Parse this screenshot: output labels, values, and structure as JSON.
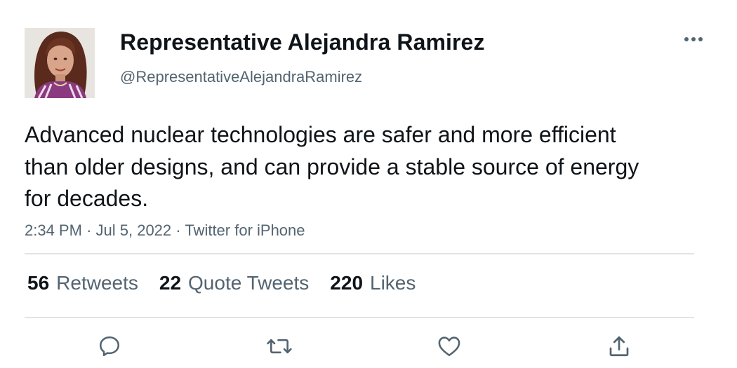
{
  "author": {
    "display_name": "Representative Alejandra Ramirez",
    "handle": "@RepresentativeAlejandraRamirez",
    "avatar_icon": "profile-photo"
  },
  "tweet": {
    "text": "Advanced nuclear technologies are safer and more efficient than older designs, and can provide a stable source of energy for decades.",
    "time": "2:34 PM",
    "date": "Jul 5, 2022",
    "source": "Twitter for iPhone",
    "separator": "·"
  },
  "stats": {
    "retweets": {
      "count": "56",
      "label": "Retweets"
    },
    "quotes": {
      "count": "22",
      "label": "Quote Tweets"
    },
    "likes": {
      "count": "220",
      "label": "Likes"
    }
  },
  "actions": {
    "reply_icon": "reply-icon",
    "retweet_icon": "retweet-icon",
    "like_icon": "heart-icon",
    "share_icon": "share-icon",
    "more_icon": "more-horizontal-icon"
  },
  "colors": {
    "text_primary": "#0f1419",
    "text_secondary": "#536471",
    "divider": "#e1e4e7",
    "icon": "#536471"
  }
}
